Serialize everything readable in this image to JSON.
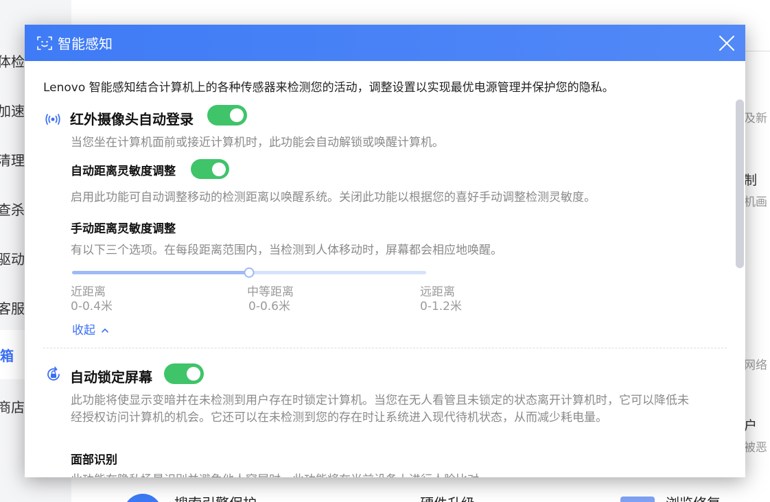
{
  "background": {
    "nav_items": [
      "体检",
      "加速",
      "清理",
      "查杀",
      "驱动",
      "客服",
      "箱",
      "商店"
    ],
    "right_items": [
      "及新",
      "制",
      "机画",
      "网络",
      "户",
      "被恶"
    ],
    "bottom_items": [
      "搜索引擎保护",
      "硬件升级",
      "浏览修复"
    ]
  },
  "dialog": {
    "title": "智能感知",
    "intro": "Lenovo 智能感知结合计算机上的各种传感器来检测您的活动，调整设置以实现最优电源管理并保护您的隐私。",
    "ir_login": {
      "title": "红外摄像头自动登录",
      "enabled": true,
      "desc": "当您坐在计算机面前或接近计算机时，此功能会自动解锁或唤醒计算机。"
    },
    "auto_distance": {
      "title": "自动距离灵敏度调整",
      "enabled": true,
      "desc": "启用此功能可自动调整移动的检测距离以唤醒系统。关闭此功能以根据您的喜好手动调整检测灵敏度。"
    },
    "manual_distance": {
      "title": "手动距离灵敏度调整",
      "desc": "有以下三个选项。在每段距离范围内，当检测到人体移动时，屏幕都会相应地唤醒。",
      "selected_index": 1,
      "options": [
        {
          "name": "近距离",
          "range": "0-0.4米"
        },
        {
          "name": "中等距离",
          "range": "0-0.6米"
        },
        {
          "name": "远距离",
          "range": "0-1.2米"
        }
      ]
    },
    "collapse_label": "收起",
    "auto_lock": {
      "title": "自动锁定屏幕",
      "enabled": true,
      "desc_line1": "此功能将使显示变暗并在未检测到用户存在时锁定计算机。当您在无人看管且未锁定的状态离开计算机时，它可以降低未",
      "desc_line2": "经授权访问计算机的机会。它还可以在未检测到您的存在时让系统进入现代待机状态，从而减少耗电量。"
    },
    "face_recognition": {
      "title": "面部识别",
      "desc_partial": "此功能在隐私场景识别并避免他人窥屏时，此功能将在当前设备上进行人脸比对。"
    }
  }
}
